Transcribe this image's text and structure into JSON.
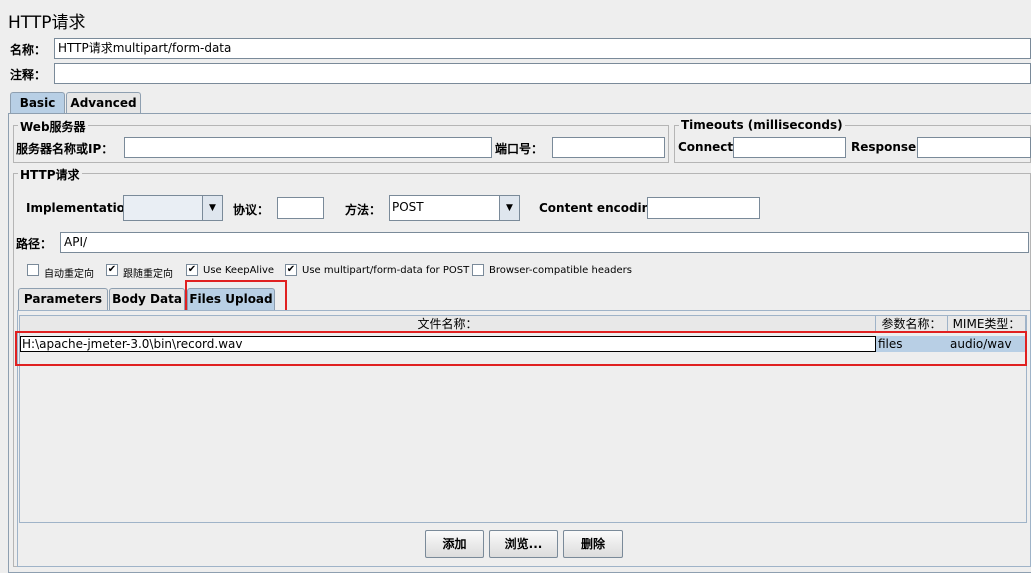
{
  "page": {
    "title": "HTTP请求"
  },
  "form": {
    "name_label": "名称：",
    "name_value": "HTTP请求multipart/form-data",
    "comment_label": "注释：",
    "comment_value": ""
  },
  "top_tabs": [
    "Basic",
    "Advanced"
  ],
  "web_server": {
    "legend": "Web服务器",
    "server_label": "服务器名称或IP：",
    "server_value": "",
    "port_label": "端口号：",
    "port_value": ""
  },
  "timeouts": {
    "legend": "Timeouts (milliseconds)",
    "connect_label": "Connect:",
    "connect_value": "",
    "response_label": "Response:",
    "response_value": ""
  },
  "http_request": {
    "legend": "HTTP请求",
    "implementation_label": "Implementation:",
    "implementation_value": "",
    "protocol_label": "协议：",
    "protocol_value": "",
    "method_label": "方法：",
    "method_value": "POST",
    "encoding_label": "Content encoding:",
    "encoding_value": "",
    "path_label": "路径：",
    "path_value": "API/"
  },
  "checkboxes": [
    {
      "label": "自动重定向",
      "checked": false
    },
    {
      "label": "跟随重定向",
      "checked": true
    },
    {
      "label": "Use KeepAlive",
      "checked": true
    },
    {
      "label": "Use multipart/form-data for POST",
      "checked": true
    },
    {
      "label": "Browser-compatible headers",
      "checked": false
    }
  ],
  "sub_tabs": [
    "Parameters",
    "Body Data",
    "Files Upload"
  ],
  "files_table": {
    "columns": [
      "文件名称：",
      "参数名称：",
      "MIME类型："
    ],
    "rows": [
      {
        "file": "H:\\apache-jmeter-3.0\\bin\\record.wav",
        "param": "files",
        "mime": "audio/wav"
      }
    ]
  },
  "buttons": {
    "add": "添加",
    "browse": "浏览...",
    "delete": "删除"
  },
  "colors": {
    "selected_tab": "#b8cfe5",
    "highlight": "#e02020",
    "row_selected": "#b8cfe5"
  }
}
